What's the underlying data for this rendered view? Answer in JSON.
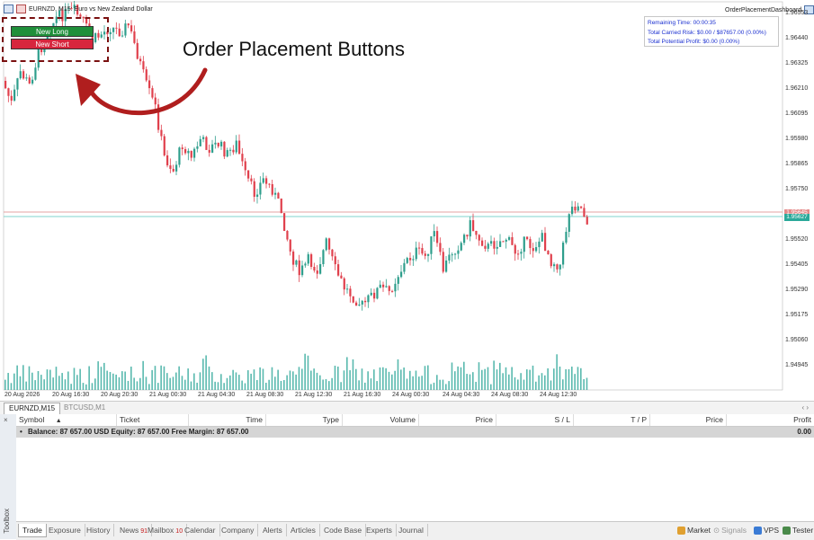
{
  "chart": {
    "symbol_title": "EURNZD, M15:  Euro vs New Zealand Dollar",
    "dashboard_title": "OrderPlacementDashboard",
    "info": {
      "remaining": "Remaining Time: 00:00:35",
      "risk": "Total Carried Risk: $0.00 / $87657.00 (0.00%)",
      "profit": "Total Potential Profit: $0.00 (0.00%)"
    },
    "buttons": {
      "long": "New Long",
      "short": "New Short"
    },
    "callout": "Order Placement Buttons",
    "price_labels": [
      "1.96553",
      "1.96440",
      "1.96325",
      "1.96210",
      "1.96095",
      "1.95980",
      "1.95865",
      "1.95750",
      "1.95635",
      "1.95520",
      "1.95405",
      "1.95290",
      "1.95175",
      "1.95060",
      "1.94945"
    ],
    "ask_tag": "1.95645",
    "bid_tag": "1.95627",
    "time_labels": [
      "20 Aug 2026",
      "20 Aug 16:30",
      "20 Aug 20:30",
      "21 Aug 00:30",
      "21 Aug 04:30",
      "21 Aug 08:30",
      "21 Aug 12:30",
      "21 Aug 16:30",
      "24 Aug 00:30",
      "24 Aug 04:30",
      "24 Aug 08:30",
      "24 Aug 12:30"
    ],
    "colors": {
      "bull": "#2e9e8c",
      "bear": "#e0404c",
      "ask_line": "#e3a3a3",
      "bid_line": "#7fd3cd"
    }
  },
  "chart_tabs": [
    "EURNZD,M15",
    "BTCUSD,M1"
  ],
  "scroll_arrows": "‹ ›",
  "toolbox_close": "×",
  "toolbox_label": "Toolbox",
  "table": {
    "headers": [
      "Symbol",
      "Ticket",
      "Time",
      "Type",
      "Volume",
      "Price",
      "S / L",
      "T / P",
      "Price",
      "Profit"
    ],
    "balance_text": "Balance: 87 657.00 USD   Equity: 87 657.00   Free Margin: 87 657.00",
    "balance_profit": "0.00"
  },
  "bottom_tabs": [
    {
      "label": "Trade",
      "badge": ""
    },
    {
      "label": "Exposure",
      "badge": ""
    },
    {
      "label": "History",
      "badge": ""
    },
    {
      "label": "News",
      "badge": "91"
    },
    {
      "label": "Mailbox",
      "badge": "10"
    },
    {
      "label": "Calendar",
      "badge": ""
    },
    {
      "label": "Company",
      "badge": ""
    },
    {
      "label": "Alerts",
      "badge": ""
    },
    {
      "label": "Articles",
      "badge": ""
    },
    {
      "label": "Code Base",
      "badge": ""
    },
    {
      "label": "Experts",
      "badge": ""
    },
    {
      "label": "Journal",
      "badge": ""
    }
  ],
  "status": {
    "market": "Market",
    "signals": "Signals",
    "vps": "VPS",
    "tester": "Tester"
  }
}
